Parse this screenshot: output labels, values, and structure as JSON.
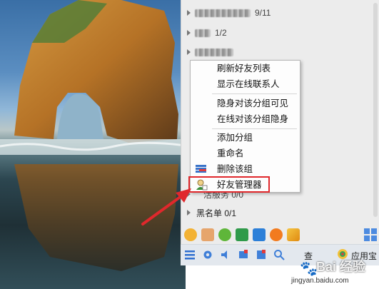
{
  "groups": [
    {
      "label_suffix": "9/11"
    },
    {
      "label_suffix": "1/2"
    },
    {
      "label_suffix": ""
    }
  ],
  "context_menu": {
    "items": [
      {
        "label": "刷新好友列表"
      },
      {
        "label": "显示在线联系人"
      },
      {
        "label": "隐身对该分组可见"
      },
      {
        "label": "在线对该分组隐身"
      },
      {
        "label": "添加分组"
      },
      {
        "label": "重命名"
      },
      {
        "label": "删除该组"
      },
      {
        "label": "好友管理器"
      }
    ]
  },
  "hidden_group": {
    "label": "陌生人/服务",
    "count": "0/0",
    "visible_part": "活服务  0/0"
  },
  "blacklist": {
    "label": "黑名单",
    "count": "0/1",
    "display": "黑名单 0/1"
  },
  "bottom_bar": {
    "app_store_label": "应用宝",
    "partial_label": "查"
  },
  "watermark": {
    "brand": "Bai 经验",
    "url": "jingyan.baidu.com"
  },
  "colors": {
    "highlight": "#e0282c",
    "menu_bg": "#fdfdfd",
    "panel_bg": "#ececec"
  }
}
